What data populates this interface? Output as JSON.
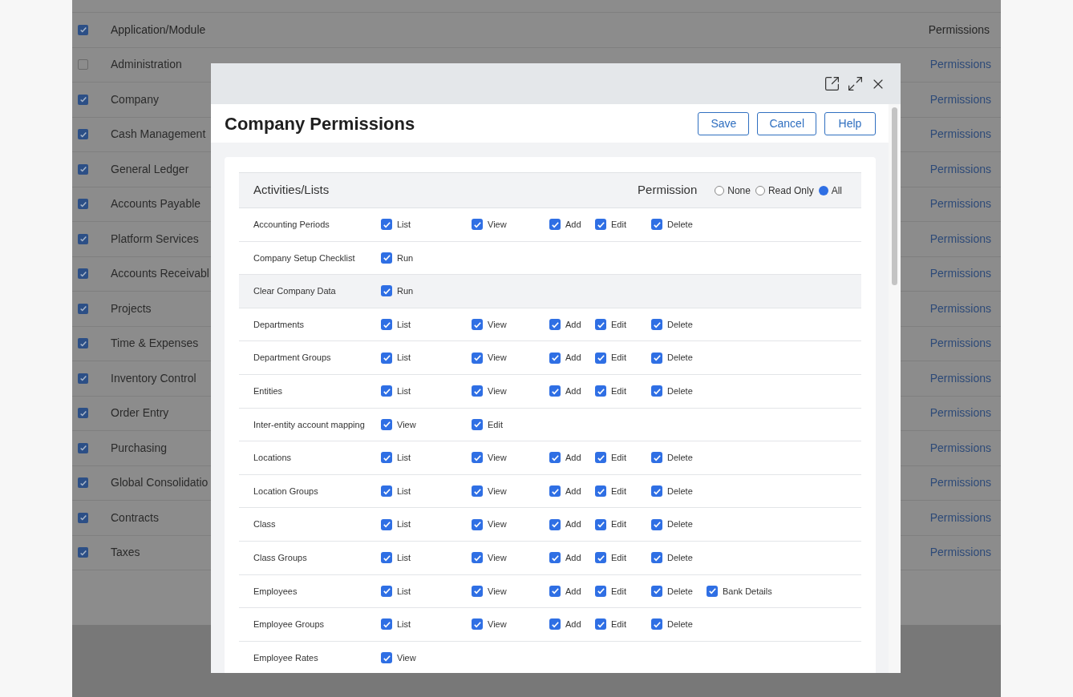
{
  "background_table": {
    "header": {
      "checked": true,
      "column_1": "Application/Module",
      "column_2": "Permissions"
    },
    "rows": [
      {
        "checked": false,
        "name": "Administration",
        "link": "Permissions"
      },
      {
        "checked": true,
        "name": "Company",
        "link": "Permissions"
      },
      {
        "checked": true,
        "name": "Cash Management",
        "link": "Permissions"
      },
      {
        "checked": true,
        "name": "General Ledger",
        "link": "Permissions"
      },
      {
        "checked": true,
        "name": "Accounts Payable",
        "link": "Permissions"
      },
      {
        "checked": true,
        "name": "Platform Services",
        "link": "Permissions"
      },
      {
        "checked": true,
        "name": "Accounts Receivabl",
        "link": "Permissions"
      },
      {
        "checked": true,
        "name": "Projects",
        "link": "Permissions"
      },
      {
        "checked": true,
        "name": "Time & Expenses",
        "link": "Permissions"
      },
      {
        "checked": true,
        "name": "Inventory Control",
        "link": "Permissions"
      },
      {
        "checked": true,
        "name": "Order Entry",
        "link": "Permissions"
      },
      {
        "checked": true,
        "name": "Purchasing",
        "link": "Permissions"
      },
      {
        "checked": true,
        "name": "Global Consolidatio",
        "link": "Permissions"
      },
      {
        "checked": true,
        "name": "Contracts",
        "link": "Permissions"
      },
      {
        "checked": true,
        "name": "Taxes",
        "link": "Permissions"
      }
    ]
  },
  "dialog": {
    "title": "Company Permissions",
    "buttons": [
      "Save",
      "Cancel",
      "Help"
    ],
    "table_header": {
      "label": "Activities/Lists",
      "permission_label": "Permission",
      "options": [
        {
          "label": "None",
          "selected": false
        },
        {
          "label": "Read Only",
          "selected": false
        },
        {
          "label": "All",
          "selected": true
        }
      ]
    },
    "rows": [
      {
        "name": "Accounting Periods",
        "highlighted": false,
        "permissions": [
          {
            "label": "List",
            "checked": true
          },
          {
            "label": "View",
            "checked": true
          },
          {
            "label": "Add",
            "checked": true
          },
          {
            "label": "Edit",
            "checked": true
          },
          {
            "label": "Delete",
            "checked": true
          }
        ]
      },
      {
        "name": "Company Setup Checklist",
        "highlighted": false,
        "permissions": [
          {
            "label": "Run",
            "checked": true
          }
        ]
      },
      {
        "name": "Clear Company Data",
        "highlighted": true,
        "permissions": [
          {
            "label": "Run",
            "checked": true
          }
        ]
      },
      {
        "name": "Departments",
        "highlighted": false,
        "permissions": [
          {
            "label": "List",
            "checked": true
          },
          {
            "label": "View",
            "checked": true
          },
          {
            "label": "Add",
            "checked": true
          },
          {
            "label": "Edit",
            "checked": true
          },
          {
            "label": "Delete",
            "checked": true
          }
        ]
      },
      {
        "name": "Department Groups",
        "highlighted": false,
        "permissions": [
          {
            "label": "List",
            "checked": true
          },
          {
            "label": "View",
            "checked": true
          },
          {
            "label": "Add",
            "checked": true
          },
          {
            "label": "Edit",
            "checked": true
          },
          {
            "label": "Delete",
            "checked": true
          }
        ]
      },
      {
        "name": "Entities",
        "highlighted": false,
        "permissions": [
          {
            "label": "List",
            "checked": true
          },
          {
            "label": "View",
            "checked": true
          },
          {
            "label": "Add",
            "checked": true
          },
          {
            "label": "Edit",
            "checked": true
          },
          {
            "label": "Delete",
            "checked": true
          }
        ]
      },
      {
        "name": "Inter-entity account mapping",
        "highlighted": false,
        "permissions": [
          {
            "label": "View",
            "checked": true
          },
          {
            "label": "Edit",
            "checked": true
          }
        ]
      },
      {
        "name": "Locations",
        "highlighted": false,
        "permissions": [
          {
            "label": "List",
            "checked": true
          },
          {
            "label": "View",
            "checked": true
          },
          {
            "label": "Add",
            "checked": true
          },
          {
            "label": "Edit",
            "checked": true
          },
          {
            "label": "Delete",
            "checked": true
          }
        ]
      },
      {
        "name": "Location Groups",
        "highlighted": false,
        "permissions": [
          {
            "label": "List",
            "checked": true
          },
          {
            "label": "View",
            "checked": true
          },
          {
            "label": "Add",
            "checked": true
          },
          {
            "label": "Edit",
            "checked": true
          },
          {
            "label": "Delete",
            "checked": true
          }
        ]
      },
      {
        "name": "Class",
        "highlighted": false,
        "permissions": [
          {
            "label": "List",
            "checked": true
          },
          {
            "label": "View",
            "checked": true
          },
          {
            "label": "Add",
            "checked": true
          },
          {
            "label": "Edit",
            "checked": true
          },
          {
            "label": "Delete",
            "checked": true
          }
        ]
      },
      {
        "name": "Class Groups",
        "highlighted": false,
        "permissions": [
          {
            "label": "List",
            "checked": true
          },
          {
            "label": "View",
            "checked": true
          },
          {
            "label": "Add",
            "checked": true
          },
          {
            "label": "Edit",
            "checked": true
          },
          {
            "label": "Delete",
            "checked": true
          }
        ]
      },
      {
        "name": "Employees",
        "highlighted": false,
        "permissions": [
          {
            "label": "List",
            "checked": true
          },
          {
            "label": "View",
            "checked": true
          },
          {
            "label": "Add",
            "checked": true
          },
          {
            "label": "Edit",
            "checked": true
          },
          {
            "label": "Delete",
            "checked": true
          },
          {
            "label": "Bank Details",
            "checked": true
          }
        ]
      },
      {
        "name": "Employee Groups",
        "highlighted": false,
        "permissions": [
          {
            "label": "List",
            "checked": true
          },
          {
            "label": "View",
            "checked": true
          },
          {
            "label": "Add",
            "checked": true
          },
          {
            "label": "Edit",
            "checked": true
          },
          {
            "label": "Delete",
            "checked": true
          }
        ]
      },
      {
        "name": "Employee Rates",
        "highlighted": false,
        "permissions": [
          {
            "label": "View",
            "checked": true
          }
        ]
      }
    ]
  }
}
